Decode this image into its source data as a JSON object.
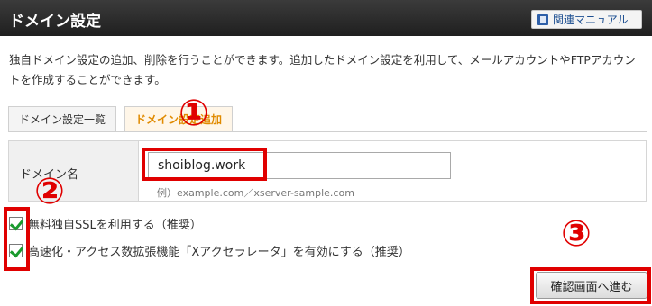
{
  "header": {
    "title": "ドメイン設定",
    "manual_label": "関連マニュアル"
  },
  "description": "独自ドメイン設定の追加、削除を行うことができます。追加したドメイン設定を利用して、メールアカウントやFTPアカウントを作成することができます。",
  "tabs": [
    {
      "label": "ドメイン設定一覧",
      "active": false
    },
    {
      "label": "ドメイン設定追加",
      "active": true
    }
  ],
  "form": {
    "domain_label": "ドメイン名",
    "domain_value": "shoiblog.work",
    "example": "例）example.com／xserver-sample.com"
  },
  "options": [
    {
      "label": "無料独自SSLを利用する（推奨）",
      "checked": true
    },
    {
      "label": "高速化・アクセス数拡張機能「Xアクセラレータ」を有効にする（推奨）",
      "checked": true
    }
  ],
  "confirm_label": "確認画面へ進む",
  "annotations": {
    "n1": "①",
    "n2": "②",
    "n3": "③"
  },
  "colors": {
    "annotation": "#e00000",
    "active_tab": "#e08a00",
    "check": "#1a9a2e"
  }
}
